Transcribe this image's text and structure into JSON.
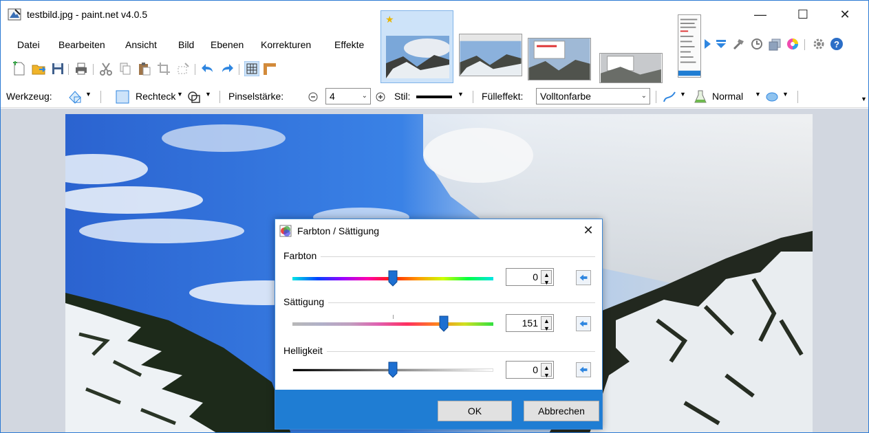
{
  "window": {
    "title": "testbild.jpg - paint.net v4.0.5",
    "controls": {
      "minimize": "—",
      "maximize": "☐",
      "close": "✕"
    }
  },
  "menu": [
    "Datei",
    "Bearbeiten",
    "Ansicht",
    "Bild",
    "Ebenen",
    "Korrekturen",
    "Effekte"
  ],
  "toolbar": {
    "tool_label": "Werkzeug:",
    "shape_label": "Rechteck",
    "brush_width_label": "Pinselstärke:",
    "brush_width_value": "4",
    "style_label": "Stil:",
    "fill_label": "Fülleffekt:",
    "fill_value": "Volltonfarbe",
    "blend_value": "Normal"
  },
  "icons": {
    "title": "paintnet-app-icon",
    "right": [
      "expand-arrow-icon",
      "collapse-arrow-icon",
      "tools-icon",
      "history-icon",
      "layers-icon",
      "colors-icon",
      "settings-icon",
      "help-icon"
    ]
  },
  "dialog": {
    "title": "Farbton / Sättigung",
    "close": "✕",
    "hue": {
      "label": "Farbton",
      "value": "0",
      "position": 0.5
    },
    "saturation": {
      "label": "Sättigung",
      "value": "151",
      "position": 0.755
    },
    "lightness": {
      "label": "Helligkeit",
      "value": "0",
      "position": 0.5
    },
    "ok_label": "OK",
    "cancel_label": "Abbrechen"
  },
  "colors": {
    "accent": "#1f7dd3",
    "highlight": "#e00000",
    "canvas_bg": "#d2d7e0"
  }
}
